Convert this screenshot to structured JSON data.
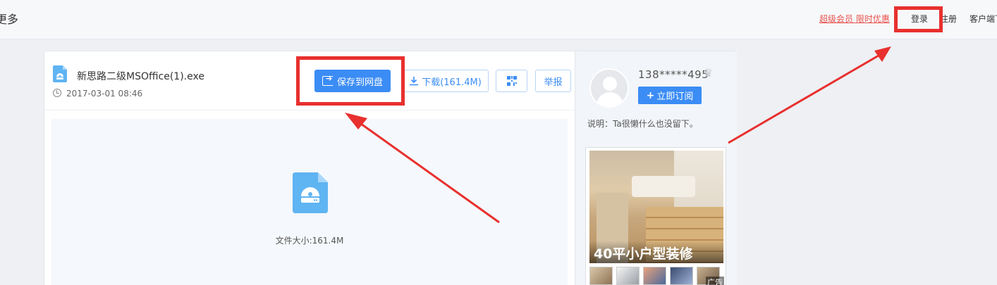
{
  "topbar": {
    "more_label": "更多",
    "vip_link": "超级会员 限时优惠",
    "login_label": "登录",
    "register_label": "注册",
    "client_label": "客户端下载"
  },
  "file": {
    "name": "新思路二级MSOffice(1).exe",
    "date": "2017-03-01 08:46",
    "icon": "file-disc-icon",
    "size_label": "文件大小:161.4M"
  },
  "actions": {
    "save_label": "保存到网盘",
    "download_label": "下载(161.4M)",
    "report_label": "举报",
    "qr_icon": "qrcode-icon"
  },
  "user": {
    "name": "138*****495",
    "subscribe_label": "立即订阅",
    "description": "说明：Ta很懒什么也没留下。"
  },
  "ad": {
    "title": "40平小户型装修",
    "badge": "广告"
  },
  "colors": {
    "accent": "#3b8cf5",
    "highlight": "#e8302e",
    "vip": "#e8534d"
  }
}
